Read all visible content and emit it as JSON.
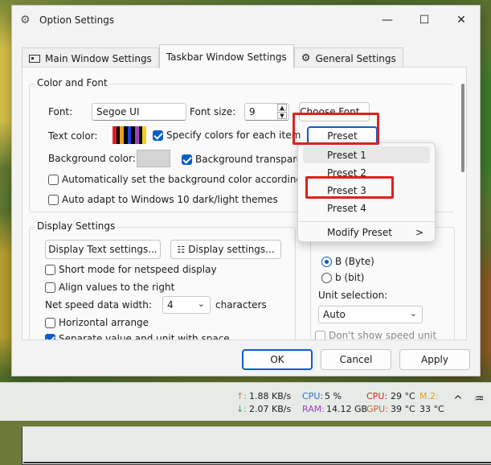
{
  "window": {
    "title": "Option Settings",
    "controls": {
      "minimize": "—",
      "maximize": "☐",
      "close": "✕"
    }
  },
  "tabs": [
    {
      "label": "Main Window Settings",
      "icon": "window-icon"
    },
    {
      "label": "Taskbar Window Settings",
      "icon": "taskbar-icon"
    },
    {
      "label": "General Settings",
      "icon": "gear-icon"
    }
  ],
  "color_font": {
    "group_title": "Color and Font",
    "font_label": "Font:",
    "font_value": "Segoe UI",
    "font_size_label": "Font size:",
    "font_size_value": "9",
    "choose_font": "Choose Font...",
    "text_color_label": "Text color:",
    "text_color_swatches": [
      "#e02020",
      "#000000",
      "#e8a020",
      "#000000",
      "#2040e0",
      "#000000",
      "#a040c0",
      "#000000",
      "#f0d020"
    ],
    "specify_colors": "Specify colors for each item",
    "preset_button": "Preset",
    "background_color_label": "Background color:",
    "background_color": "#d4d4d4",
    "background_transparent": "Background transparent",
    "auto_bg": "Automatically set the background color according to the",
    "auto_adapt": "Auto adapt to Windows 10 dark/light themes"
  },
  "display": {
    "group_title": "Display Settings",
    "display_text_btn": "Display Text settings...",
    "display_settings_btn": "Display settings...",
    "short_mode": "Short mode for netspeed display",
    "align_right": "Align values to the right",
    "width_label": "Net speed data width:",
    "width_value": "4",
    "characters": "characters",
    "horizontal": "Horizontal arrange",
    "separate": "Separate value and unit with space"
  },
  "unit": {
    "b_byte": "B (Byte)",
    "b_bit": "b (bit)",
    "selection_label": "Unit selection:",
    "selection_value": "Auto",
    "dont_show": "Don't show speed unit"
  },
  "preset_menu": {
    "items": [
      "Preset 1",
      "Preset 2",
      "Preset 3",
      "Preset 4"
    ],
    "modify": "Modify Preset",
    "submenu_arrow": ">"
  },
  "footer": {
    "ok": "OK",
    "cancel": "Cancel",
    "apply": "Apply"
  },
  "taskbar": {
    "up_arrow": "↑:",
    "up_value": "1.88 KB/s",
    "down_arrow": "↓:",
    "down_value": "2.07 KB/s",
    "cpu_label": "CPU:",
    "cpu_value": "5 %",
    "ram_label": "RAM:",
    "ram_value": "14.12 GB",
    "cpu_temp_label": "CPU:",
    "cpu_temp_value": "29 °C",
    "gpu_temp_label": "GPU:",
    "gpu_temp_value": "39 °C",
    "m2_label": "M.2:",
    "m2_value": "33 °C",
    "chevron": "^",
    "colors": {
      "up": "#d08a2a",
      "down": "#3aa050",
      "cpu": "#2a6fd0",
      "ram": "#a040c0",
      "cpu_temp": "#e02020",
      "gpu": "#c06030",
      "m2": "#e0a020"
    }
  }
}
